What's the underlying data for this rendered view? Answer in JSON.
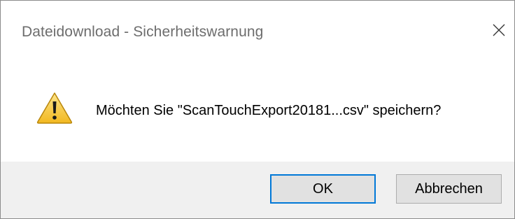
{
  "window": {
    "title": "Dateidownload - Sicherheitswarnung",
    "close_icon": "close-icon"
  },
  "content": {
    "icon": "warning-icon",
    "message": "Möchten Sie \"ScanTouchExport20181...csv\" speichern?"
  },
  "buttons": {
    "ok_label": "OK",
    "cancel_label": "Abbrechen"
  },
  "colors": {
    "accent": "#0078d7",
    "footer_bg": "#f0f0f0",
    "warning_yellow": "#f7c631"
  }
}
